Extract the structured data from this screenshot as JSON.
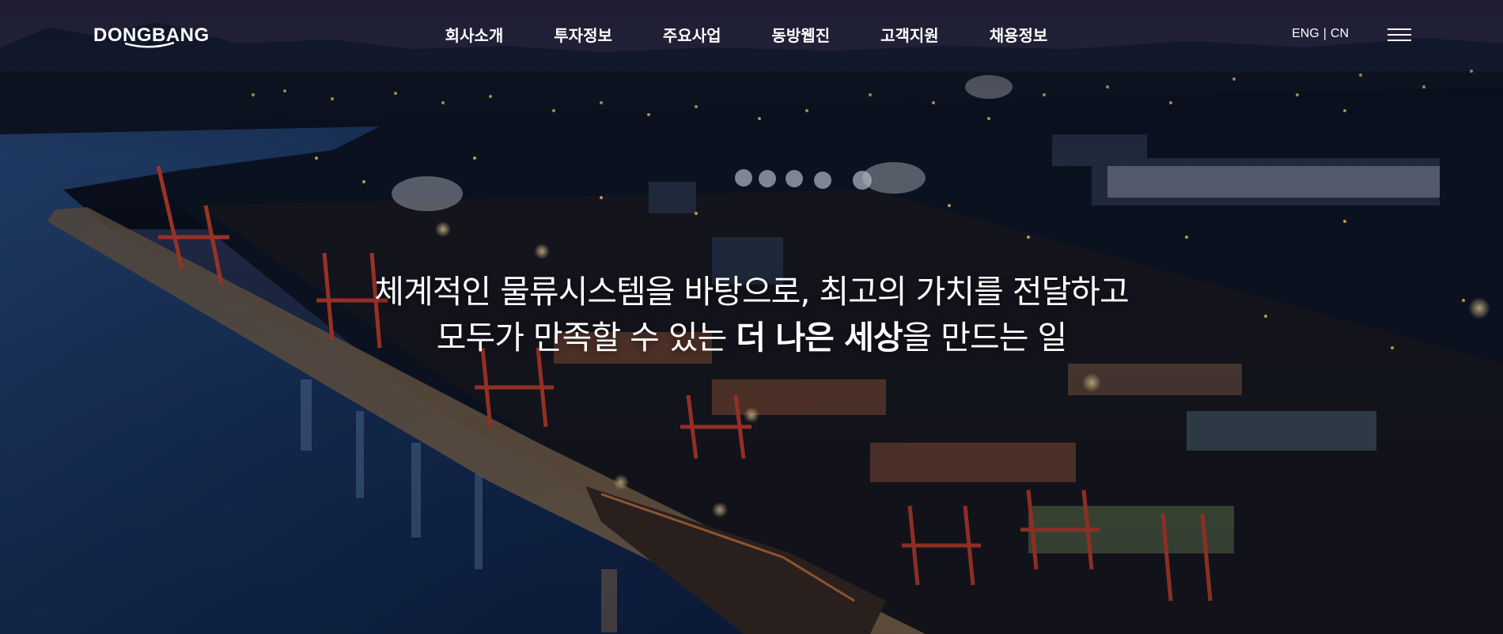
{
  "brand": {
    "logo_text": "DONGBANG"
  },
  "nav": {
    "items": [
      {
        "label": "회사소개"
      },
      {
        "label": "투자정보"
      },
      {
        "label": "주요사업"
      },
      {
        "label": "동방웹진"
      },
      {
        "label": "고객지원"
      },
      {
        "label": "채용정보"
      }
    ]
  },
  "lang": {
    "eng": "ENG",
    "separator": "|",
    "cn": "CN"
  },
  "menu": {
    "icon": "hamburger-menu-icon"
  },
  "hero": {
    "line1": "체계적인 물류시스템을 바탕으로, 최고의 가치를 전달하고",
    "line2_prefix": "모두가 만족할 수 있는 ",
    "line2_strong": "더 나은 세상",
    "line2_suffix": "을 만드는 일"
  },
  "colors": {
    "text": "#ffffff",
    "sky_top": "#2b3150",
    "sea": "#1a3560",
    "city_lights": "#f4c46a",
    "crane_red": "#c8402c"
  }
}
